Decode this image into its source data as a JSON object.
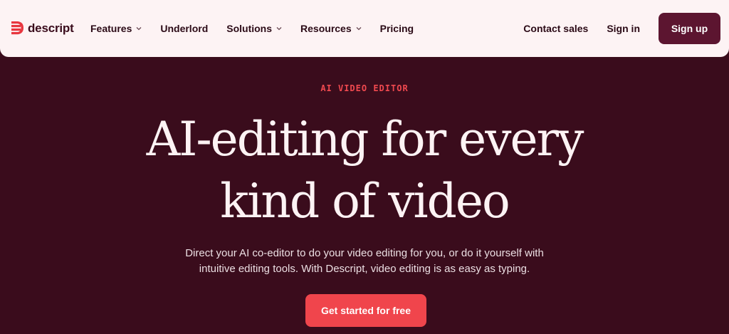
{
  "brand": {
    "name": "descript",
    "logo_icon": "descript-logo-icon",
    "accent": "#e8363f"
  },
  "nav": {
    "items": [
      {
        "label": "Features",
        "has_dropdown": true
      },
      {
        "label": "Underlord",
        "has_dropdown": false
      },
      {
        "label": "Solutions",
        "has_dropdown": true
      },
      {
        "label": "Resources",
        "has_dropdown": true
      },
      {
        "label": "Pricing",
        "has_dropdown": false
      }
    ],
    "contact_label": "Contact sales",
    "signin_label": "Sign in",
    "signup_label": "Sign up"
  },
  "hero": {
    "eyebrow": "AI VIDEO EDITOR",
    "headline_line1": "AI-editing for every",
    "headline_line2": "kind of video",
    "subtext_line1": "Direct your AI co-editor to do your video editing for you, or do it yourself with",
    "subtext_line2": "intuitive editing tools. With Descript, video editing is as easy as typing.",
    "cta_label": "Get started for free"
  },
  "colors": {
    "nav_bg": "#fdf3f4",
    "page_bg": "#3a0c1c",
    "signup_bg": "#5c1530",
    "cta_bg": "#f0454c",
    "eyebrow": "#f0494f"
  }
}
